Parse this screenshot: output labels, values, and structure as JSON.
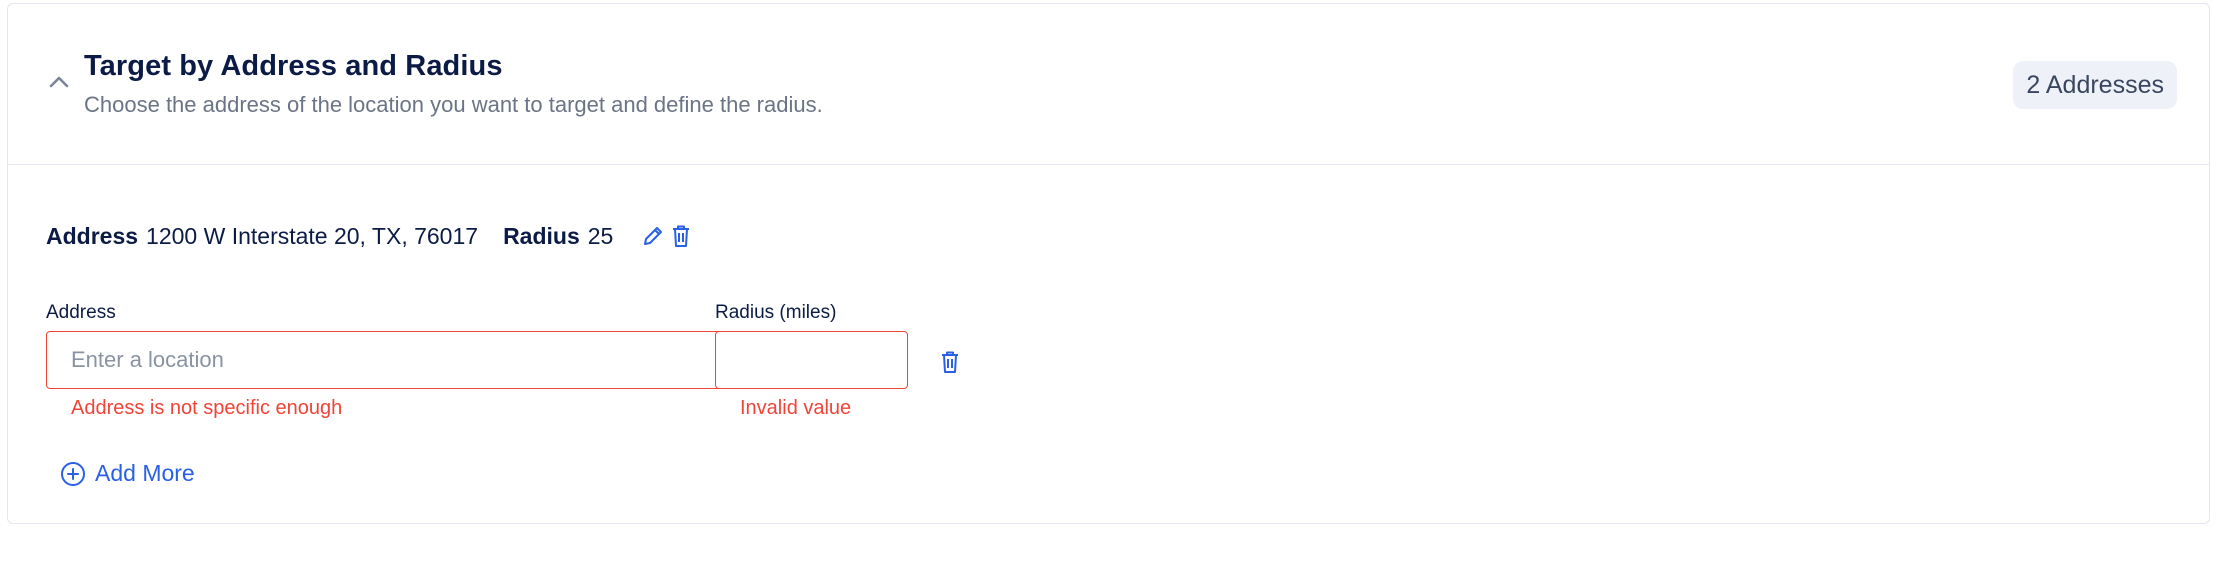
{
  "section": {
    "title": "Target by Address and Radius",
    "subtitle": "Choose the address of the location you want to target and define the radius.",
    "badge": "2 Addresses"
  },
  "saved_address": {
    "address_label": "Address",
    "address_value": "1200 W Interstate 20, TX, 76017",
    "radius_label": "Radius",
    "radius_value": "25"
  },
  "form": {
    "address_label": "Address",
    "address_placeholder": "Enter a location",
    "address_value": "",
    "address_error": "Address is not specific enough",
    "radius_label": "Radius (miles)",
    "radius_value": "",
    "radius_error": "Invalid value"
  },
  "add_more_label": "Add More",
  "colors": {
    "accent": "#2a5fe8",
    "error": "#f04438",
    "title": "#0b1b45"
  },
  "icons": [
    "chevron-up-icon",
    "pencil-icon",
    "trash-icon",
    "plus-circle-icon"
  ]
}
